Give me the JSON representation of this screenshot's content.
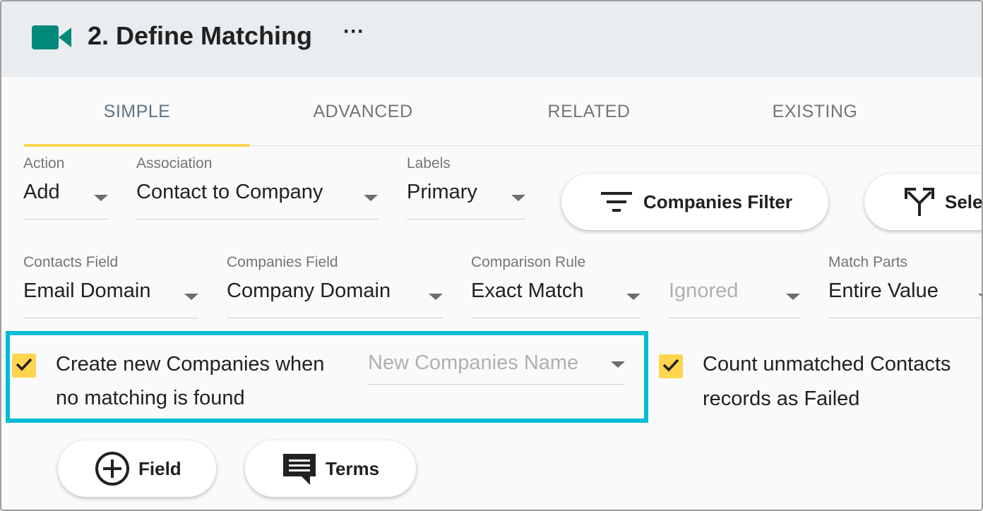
{
  "header": {
    "title": "2. Define Matching",
    "more_label": "···",
    "icon": "video-camera-icon",
    "icon_color": "#00897b"
  },
  "tabs": [
    {
      "label": "SIMPLE",
      "active": true
    },
    {
      "label": "ADVANCED",
      "active": false
    },
    {
      "label": "RELATED",
      "active": false
    },
    {
      "label": "EXISTING",
      "active": false
    }
  ],
  "row1": {
    "action": {
      "label": "Action",
      "value": "Add"
    },
    "association": {
      "label": "Association",
      "value": "Contact to Company"
    },
    "labels": {
      "label": "Labels",
      "value": "Primary"
    },
    "companies_filter": {
      "label": "Companies Filter",
      "icon": "filter-icon"
    },
    "select": {
      "label": "Sele",
      "icon": "split-arrow-icon"
    }
  },
  "row2": {
    "contacts_field": {
      "label": "Contacts Field",
      "value": "Email Domain"
    },
    "companies_field": {
      "label": "Companies Field",
      "value": "Company Domain"
    },
    "comparison_rule": {
      "label": "Comparison Rule",
      "value": "Exact Match"
    },
    "ignored": {
      "value": "Ignored"
    },
    "match_parts": {
      "label": "Match Parts",
      "value": "Entire Value"
    }
  },
  "options": {
    "create_new": {
      "checked": true,
      "line1": "Create new Companies when",
      "line2": "no matching is found",
      "name_placeholder": "New Companies Name"
    },
    "count_unmatched": {
      "checked": true,
      "line1": "Count unmatched Contacts",
      "line2": "records as Failed"
    }
  },
  "buttons": {
    "field": {
      "label": "Field",
      "icon": "add-circle-icon"
    },
    "terms": {
      "label": "Terms",
      "icon": "comment-icon"
    }
  },
  "colors": {
    "accent": "#ffd54f",
    "highlight": "#00bcd4",
    "active_tab": "#5f7482"
  }
}
